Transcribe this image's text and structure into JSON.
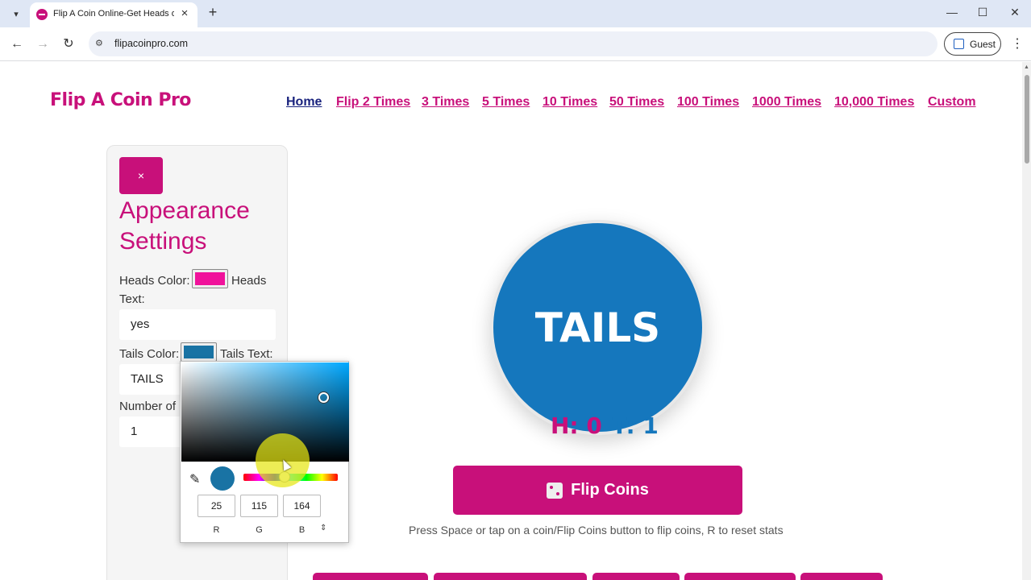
{
  "browser": {
    "tab_title": "Flip A Coin Online-Get Heads or Tails",
    "url": "flipacoinpro.com",
    "profile_label": "Guest"
  },
  "site": {
    "logo": "Flip A Coin Pro",
    "nav": [
      "Home",
      "Flip 2 Times",
      "3 Times",
      "5 Times",
      "10 Times",
      "50 Times",
      "100 Times",
      "1000 Times",
      "10,000 Times",
      "Custom"
    ],
    "active_nav": "Home"
  },
  "settings": {
    "close_label": "×",
    "title": "Appearance Settings",
    "heads_color_label": "Heads Color:",
    "heads_color": "#f0129b",
    "heads_text_label": "Heads Text:",
    "heads_text_value": "yes",
    "tails_color_label": "Tails Color:",
    "tails_color": "#1973a4",
    "tails_text_label": "Tails Text:",
    "tails_text_value": "TAILS",
    "num_label": "Number of",
    "num_value": "1"
  },
  "color_picker": {
    "r": "25",
    "g": "115",
    "b": "164",
    "r_label": "R",
    "g_label": "G",
    "b_label": "B",
    "preview_color": "#1973a4"
  },
  "coin": {
    "text": "TAILS",
    "color": "#1577bd"
  },
  "stats": {
    "heads": "H: 0",
    "tails": "T: 1"
  },
  "flip_button": "Flip Coins",
  "hint": "Press Space or tap on a coin/Flip Coins button to flip coins, R to reset stats",
  "colors": {
    "brand": "#c8107a",
    "nav_active": "#1a237e"
  }
}
